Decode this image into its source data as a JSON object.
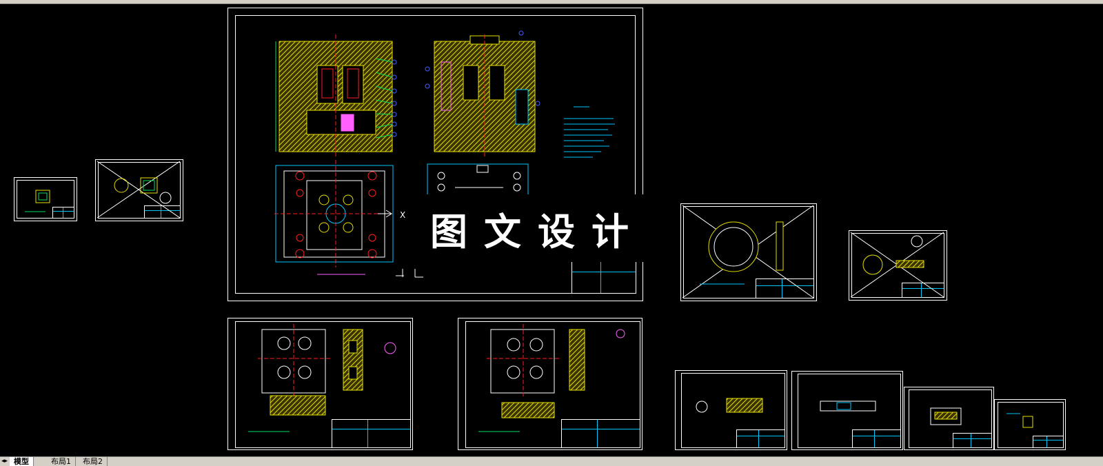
{
  "watermark": {
    "text": "图文设计"
  },
  "tabs": {
    "nav": "◂▸",
    "model": "模型",
    "layout1": "布局1",
    "layout2": "布局2"
  },
  "colors": {
    "background": "#000000",
    "frame": "#ffffff",
    "hatch": "#e8e000",
    "dim": "#00c8ff",
    "center": "#ff2020",
    "label": "#4060ff",
    "pink": "#ff60ff",
    "green": "#00e060"
  }
}
